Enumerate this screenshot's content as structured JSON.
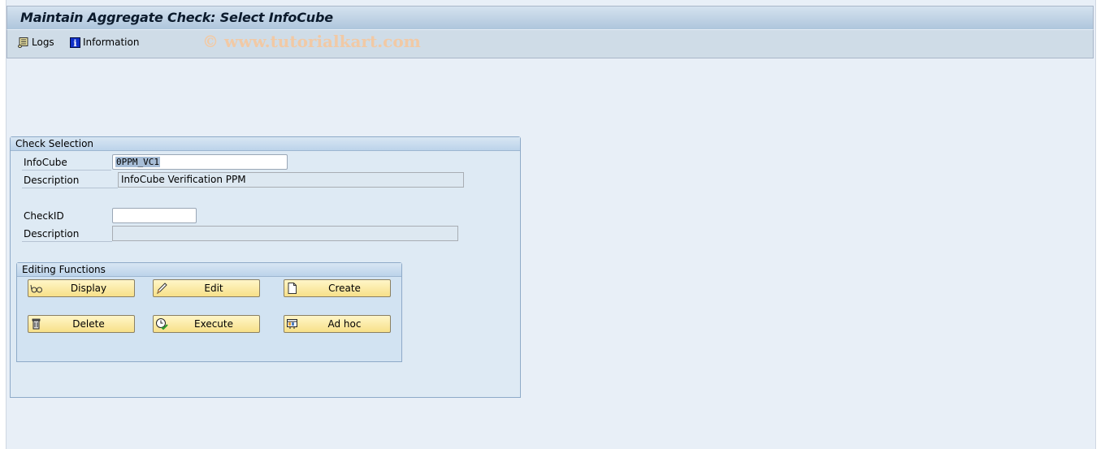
{
  "window": {
    "title": "Maintain Aggregate Check: Select InfoCube"
  },
  "toolbar": {
    "items": [
      {
        "label": "Logs",
        "icon": "scroll-icon"
      },
      {
        "label": "Information",
        "icon": "info-icon"
      }
    ],
    "watermark": "© www.tutorialkart.com"
  },
  "check_selection": {
    "title": "Check Selection",
    "infocube_label": "InfoCube",
    "infocube_value": "0PPM_VC1",
    "infocube_description_label": "Description",
    "infocube_description_value": "InfoCube Verification PPM",
    "checkid_label": "CheckID",
    "checkid_value": "",
    "check_description_label": "Description",
    "check_description_value": ""
  },
  "editing_functions": {
    "title": "Editing Functions",
    "buttons": [
      {
        "label": "Display",
        "icon": "glasses-icon"
      },
      {
        "label": "Edit",
        "icon": "pencil-icon"
      },
      {
        "label": "Create",
        "icon": "new-document-icon"
      },
      {
        "label": "Delete",
        "icon": "trash-icon"
      },
      {
        "label": "Execute",
        "icon": "execute-clock-icon"
      },
      {
        "label": "Ad hoc",
        "icon": "ad-hoc-icon"
      }
    ]
  }
}
